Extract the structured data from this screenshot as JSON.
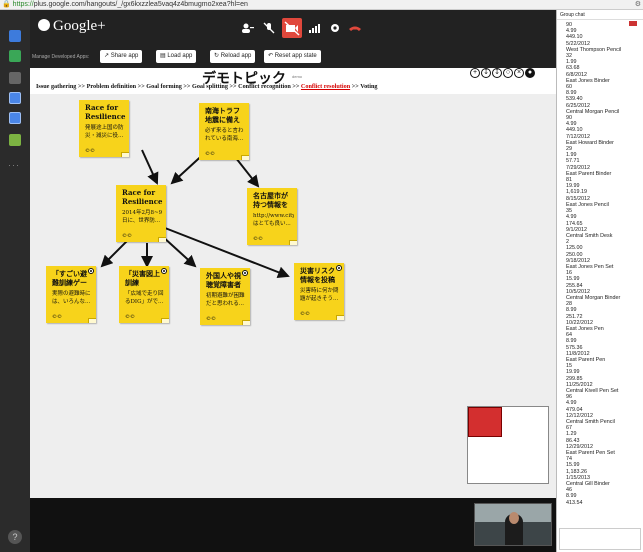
{
  "browser": {
    "url_scheme": "https://",
    "url_rest": "plus.google.com/hangouts/_/gx6kxzzlea5vaq4z4bmugmo2xea?hl=en",
    "menu_icon": "wrench-icon"
  },
  "hangout": {
    "logo": "Google+",
    "manage_label": "Manage Developed Apps:",
    "buttons": {
      "share": "Share app",
      "load": "Load app",
      "reload": "Reload app",
      "reset": "Reset app state"
    }
  },
  "app": {
    "title": "デモトピック",
    "title_sub": "demo",
    "steps": [
      {
        "label": "Issue gathering"
      },
      {
        "label": "Problem definition"
      },
      {
        "label": "Goal forming"
      },
      {
        "label": "Goal splitting"
      },
      {
        "label": "Conflict recognition"
      },
      {
        "label": "Conflict resolution",
        "active": true
      },
      {
        "label": "Voting"
      }
    ],
    "sep": ">>",
    "stickies": [
      {
        "title": "Race for Resilience: ...",
        "body": "発展途上国の防災・減災に役...",
        "cc": "cc"
      },
      {
        "title": "南海トラフ地震に備える",
        "body": "必ず来ると言われている南海...",
        "cc": "cc"
      },
      {
        "title": "Race for Resilience i...",
        "body": "2014年2月8~9日に、世界防...",
        "cc": "cc"
      },
      {
        "title": "名古屋市が持つ情報を一...",
        "body": "http://www.city.na はとても良い...",
        "cc": "cc"
      },
      {
        "title": "「すごい避難訓練ゲーム...",
        "body": "実際の避難時には、いろんな...",
        "cc": "cc"
      },
      {
        "title": "「災害図上訓練（DIG）...",
        "body": "「広域で走り回るDIG」がで...",
        "cc": "cc"
      },
      {
        "title": "外国人や視聴覚障害者が...",
        "body": "初期避難が困難だと思われる...",
        "cc": "cc"
      },
      {
        "title": "災害リスク情報を投稿し...",
        "body": "災害時に何か問題が起きそう...",
        "cc": "cc"
      }
    ]
  },
  "chat": {
    "header": "Group chat",
    "messages": [
      "90",
      "4.99",
      "449.10",
      "5/22/2012",
      "West Thompson Pencil",
      "32",
      "1.99",
      "63.68",
      "6/8/2012",
      "East Jones Binder",
      "60",
      "8.99",
      "539.40",
      "6/25/2012",
      "Central Morgan Pencil",
      "90",
      "4.99",
      "449.10",
      "7/12/2012",
      "East Howard Binder",
      "29",
      "1.99",
      "57.71",
      "7/29/2012",
      "East Parent Binder",
      "81",
      "19.99",
      "1,619.19",
      "8/15/2012",
      "East Jones Pencil",
      "35",
      "4.99",
      "174.65",
      "9/1/2012",
      "Central Smith Desk",
      "2",
      "125.00",
      "250.00",
      "9/18/2012",
      "East Jones Pen Set",
      "16",
      "15.99",
      "255.84",
      "10/5/2012",
      "Central Morgan Binder",
      "28",
      "8.99",
      "251.72",
      "10/22/2012",
      "East Jones Pen",
      "64",
      "8.99",
      "575.36",
      "11/8/2012",
      "East Parent Pen",
      "15",
      "19.99",
      "299.85",
      "11/25/2012",
      "Central Kivell Pen Set",
      "96",
      "4.99",
      "479.04",
      "12/12/2012",
      "Central Smith Pencil",
      "67",
      "1.29",
      "86.43",
      "12/29/2012",
      "East Parent Pen Set",
      "74",
      "15.99",
      "1,183.26",
      "1/15/2013",
      "Central Gill Binder",
      "46",
      "8.99",
      "413.54"
    ]
  },
  "colors": {
    "sticky": "#f7d31b",
    "active_step": "#d60000",
    "minimap_view": "#d32f2f",
    "end_call": "#e0483c"
  }
}
